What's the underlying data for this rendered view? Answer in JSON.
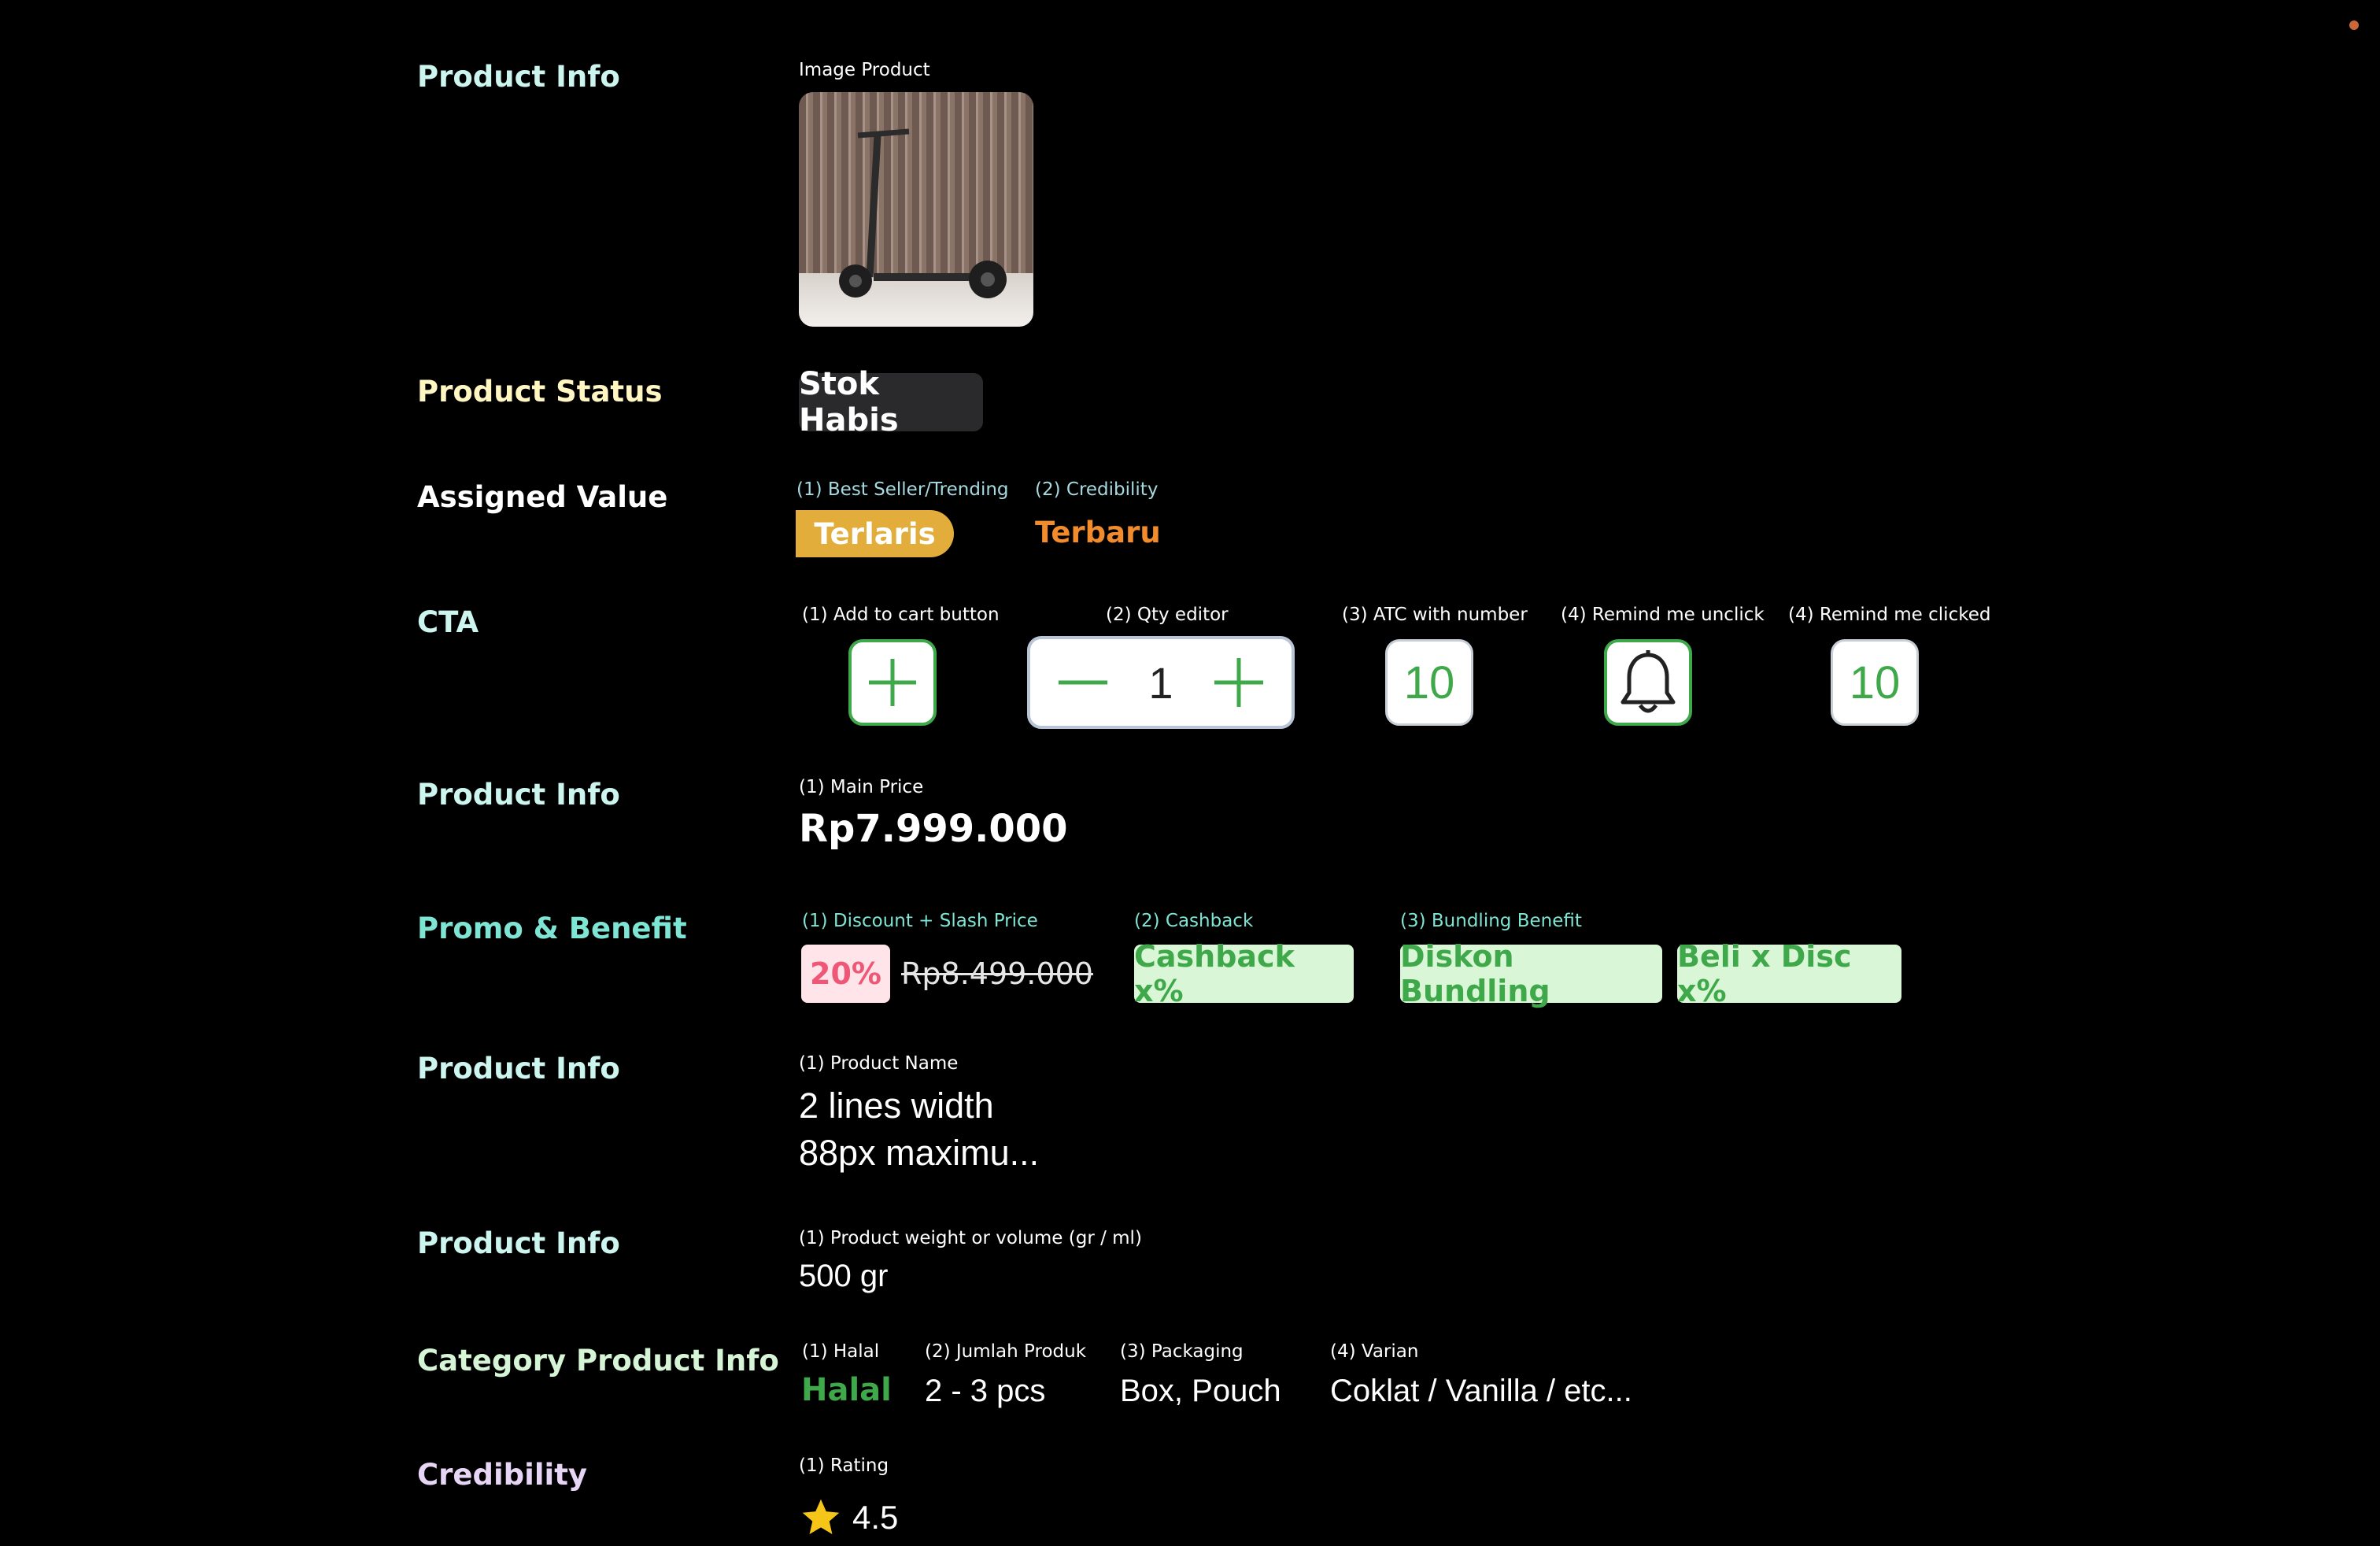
{
  "sections": {
    "product_info_image": {
      "label": "Product Info",
      "color": "#cdf5f0"
    },
    "product_status": {
      "label": "Product Status",
      "color": "#fff6c2"
    },
    "assigned_value": {
      "label": "Assigned Value",
      "color": "#ffffff"
    },
    "cta": {
      "label": "CTA",
      "color": "#cdf5f0"
    },
    "product_info_price": {
      "label": "Product Info",
      "color": "#cdf5f0"
    },
    "promo": {
      "label": "Promo & Benefit",
      "color": "#7ee4d3"
    },
    "product_info_name": {
      "label": "Product Info",
      "color": "#cdf5f0"
    },
    "product_info_weight": {
      "label": "Product Info",
      "color": "#cdf5f0"
    },
    "category": {
      "label": "Category Product Info",
      "color": "#d6f5d6"
    },
    "credibility": {
      "label": "Credibility",
      "color": "#e7d5f5"
    }
  },
  "image_product": {
    "label": "Image Product"
  },
  "status": {
    "badge": "Stok Habis"
  },
  "assigned": {
    "label1": "(1) Best Seller/Trending",
    "label2": "(2) Credibility",
    "terlaris": "Terlaris",
    "terbaru": "Terbaru"
  },
  "cta": {
    "label1": "(1) Add to cart button",
    "label2": "(2) Qty editor",
    "label3": "(3) ATC with number",
    "label4": "(4) Remind me unclick",
    "label5": "(4) Remind me clicked",
    "qty": "1",
    "atc_number": "10",
    "remind_number": "10"
  },
  "price": {
    "label": "(1) Main Price",
    "value": "Rp7.999.000"
  },
  "promo": {
    "label1": "(1) Discount + Slash Price",
    "label2": "(2) Cashback",
    "label3": "(3) Bundling Benefit",
    "discount": "20%",
    "slash": "Rp8.499.000",
    "cashback": "Cashback x%",
    "bundling": "Diskon Bundling",
    "beli": "Beli x Disc x%"
  },
  "name": {
    "label": "(1) Product Name",
    "line1": "2 lines width",
    "line2": "88px maximu..."
  },
  "weight": {
    "label": "(1) Product weight or volume (gr / ml)",
    "value": "500 gr"
  },
  "category": {
    "label1": "(1) Halal",
    "label2": "(2) Jumlah Produk",
    "label3": "(3) Packaging",
    "label4": "(4) Varian",
    "halal": "Halal",
    "jumlah": "2 - 3 pcs",
    "packaging": "Box, Pouch",
    "varian": "Coklat / Vanilla / etc..."
  },
  "rating": {
    "label": "(1) Rating",
    "value": "4.5"
  },
  "icons": [
    "plus-icon",
    "minus-icon",
    "bell-icon",
    "star-icon"
  ],
  "colors": {
    "accent_green": "#3fa84a",
    "gold": "#e3ad3b",
    "orange": "#f28b2c",
    "pink": "#ef5777"
  }
}
